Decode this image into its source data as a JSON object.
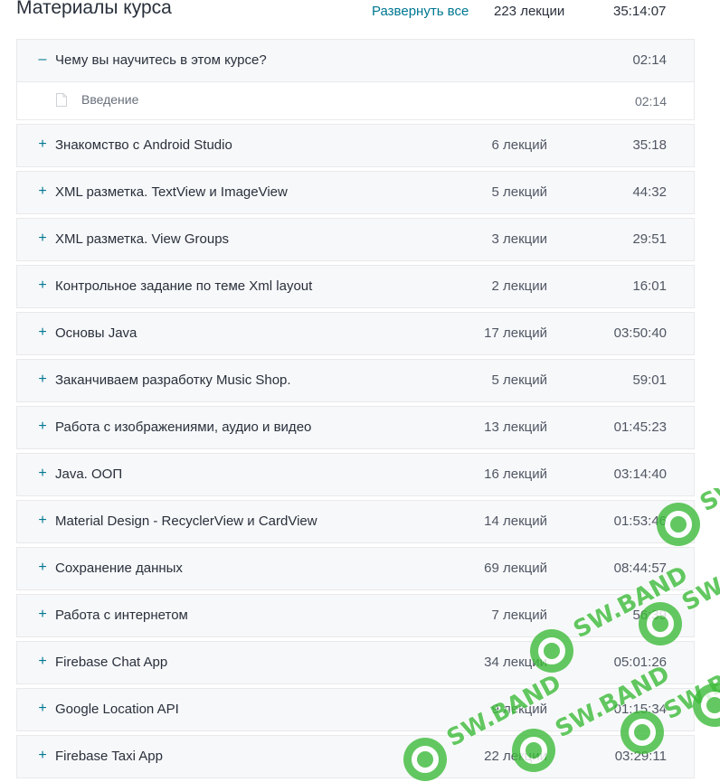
{
  "header": {
    "title": "Материалы курса",
    "expand_all": "Развернуть все",
    "total_lectures": "223 лекции",
    "total_time": "35:14:07"
  },
  "open_section": {
    "toggle": "–",
    "title": "Чему вы научитесь в этом курсе?",
    "time": "02:14",
    "lectures": [
      {
        "icon": "document-icon",
        "title": "Введение",
        "time": "02:14"
      }
    ]
  },
  "sections": [
    {
      "toggle": "+",
      "title": "Знакомство с Android Studio",
      "count": "6 лекций",
      "time": "35:18"
    },
    {
      "toggle": "+",
      "title": "XML разметка. TextView и ImageView",
      "count": "5 лекций",
      "time": "44:32"
    },
    {
      "toggle": "+",
      "title": "XML разметка. View Groups",
      "count": "3 лекции",
      "time": "29:51"
    },
    {
      "toggle": "+",
      "title": "Контрольное задание по теме Xml layout",
      "count": "2 лекции",
      "time": "16:01"
    },
    {
      "toggle": "+",
      "title": "Основы Java",
      "count": "17 лекций",
      "time": "03:50:40"
    },
    {
      "toggle": "+",
      "title": "Заканчиваем разработку Music Shop.",
      "count": "5 лекций",
      "time": "59:01"
    },
    {
      "toggle": "+",
      "title": "Работа с изображениями, аудио и видео",
      "count": "13 лекций",
      "time": "01:45:23"
    },
    {
      "toggle": "+",
      "title": "Java. ООП",
      "count": "16 лекций",
      "time": "03:14:40"
    },
    {
      "toggle": "+",
      "title": "Material Design - RecyclerView и CardView",
      "count": "14 лекций",
      "time": "01:53:46"
    },
    {
      "toggle": "+",
      "title": "Сохранение данных",
      "count": "69 лекций",
      "time": "08:44:57"
    },
    {
      "toggle": "+",
      "title": "Работа с интернетом",
      "count": "7 лекций",
      "time": "56:39"
    },
    {
      "toggle": "+",
      "title": "Firebase Chat App",
      "count": "34 лекции",
      "time": "05:01:26"
    },
    {
      "toggle": "+",
      "title": "Google Location API",
      "count": "9 лекций",
      "time": "01:15:34"
    },
    {
      "toggle": "+",
      "title": "Firebase Taxi App",
      "count": "22 лекции",
      "time": "03:29:11"
    }
  ],
  "watermark": {
    "text": "SW.BAND",
    "logo_letter": "S",
    "color": "#3dbb3a"
  }
}
